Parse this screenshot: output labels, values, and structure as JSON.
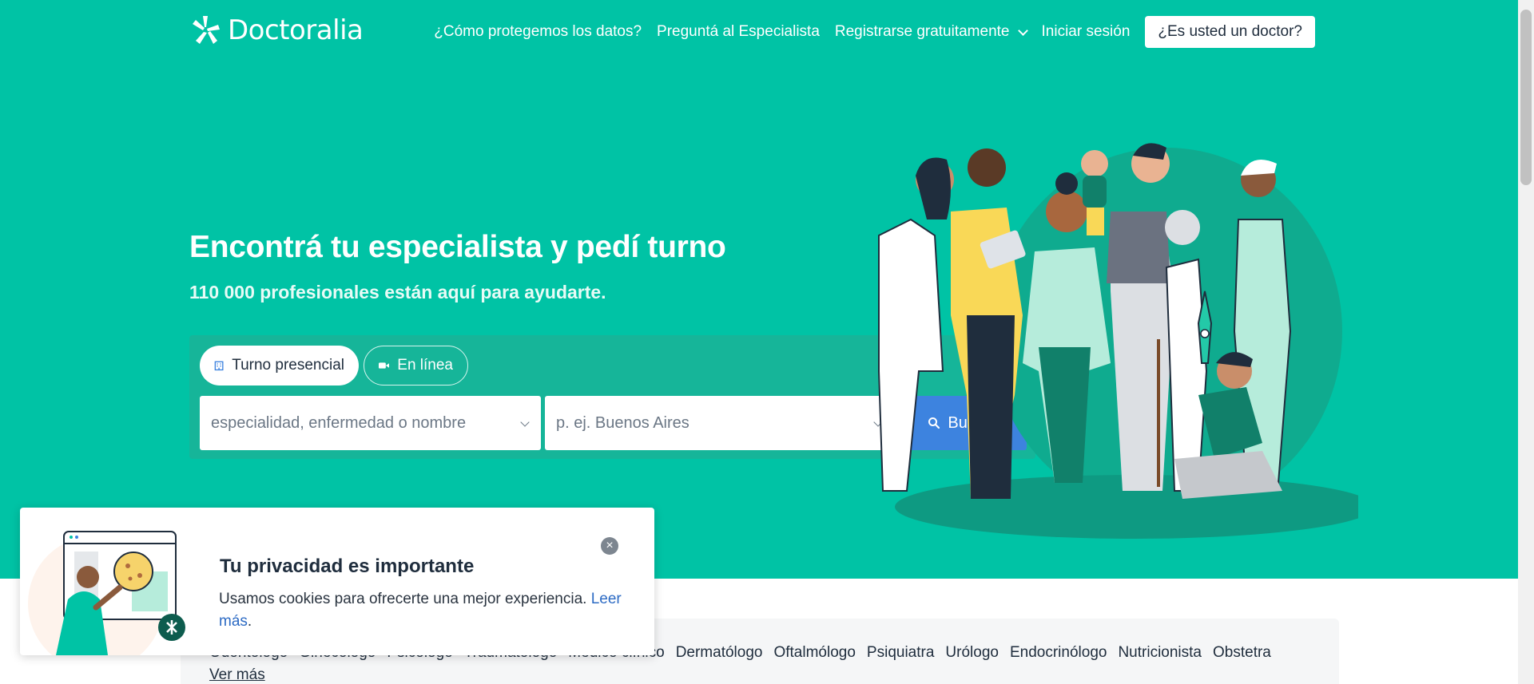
{
  "header": {
    "logo_text": "Doctoralia",
    "nav": [
      "¿Cómo protegemos los datos?",
      "Preguntá al Especialista",
      "Registrarse gratuitamente",
      "Iniciar sesión"
    ],
    "doctor_button": "¿Es usted un doctor?"
  },
  "hero": {
    "title": "Encontrá tu especialista y pedí turno",
    "subtitle": "110 000 profesionales están aquí para ayudarte."
  },
  "search": {
    "tab_in_person": "Turno presencial",
    "tab_online": "En línea",
    "specialty_placeholder": "especialidad, enfermedad o nombre",
    "location_placeholder": "p. ej. Buenos Aires",
    "search_button": "Buscar"
  },
  "specialties": {
    "items": [
      "Odontólogo",
      "Ginecólogo",
      "Psicólogo",
      "Traumatólogo",
      "Médico clínico",
      "Dermatólogo",
      "Oftalmólogo",
      "Psiquiatra",
      "Urólogo",
      "Endocrinólogo",
      "Nutricionista",
      "Obstetra"
    ],
    "more": "Ver más"
  },
  "cookie": {
    "title": "Tu privacidad es importante",
    "text": "Usamos cookies para ofrecerte una mejor experiencia.",
    "link": "Leer más",
    "period": "."
  },
  "colors": {
    "brand": "#00c3a5",
    "search_button": "#3d83df"
  }
}
